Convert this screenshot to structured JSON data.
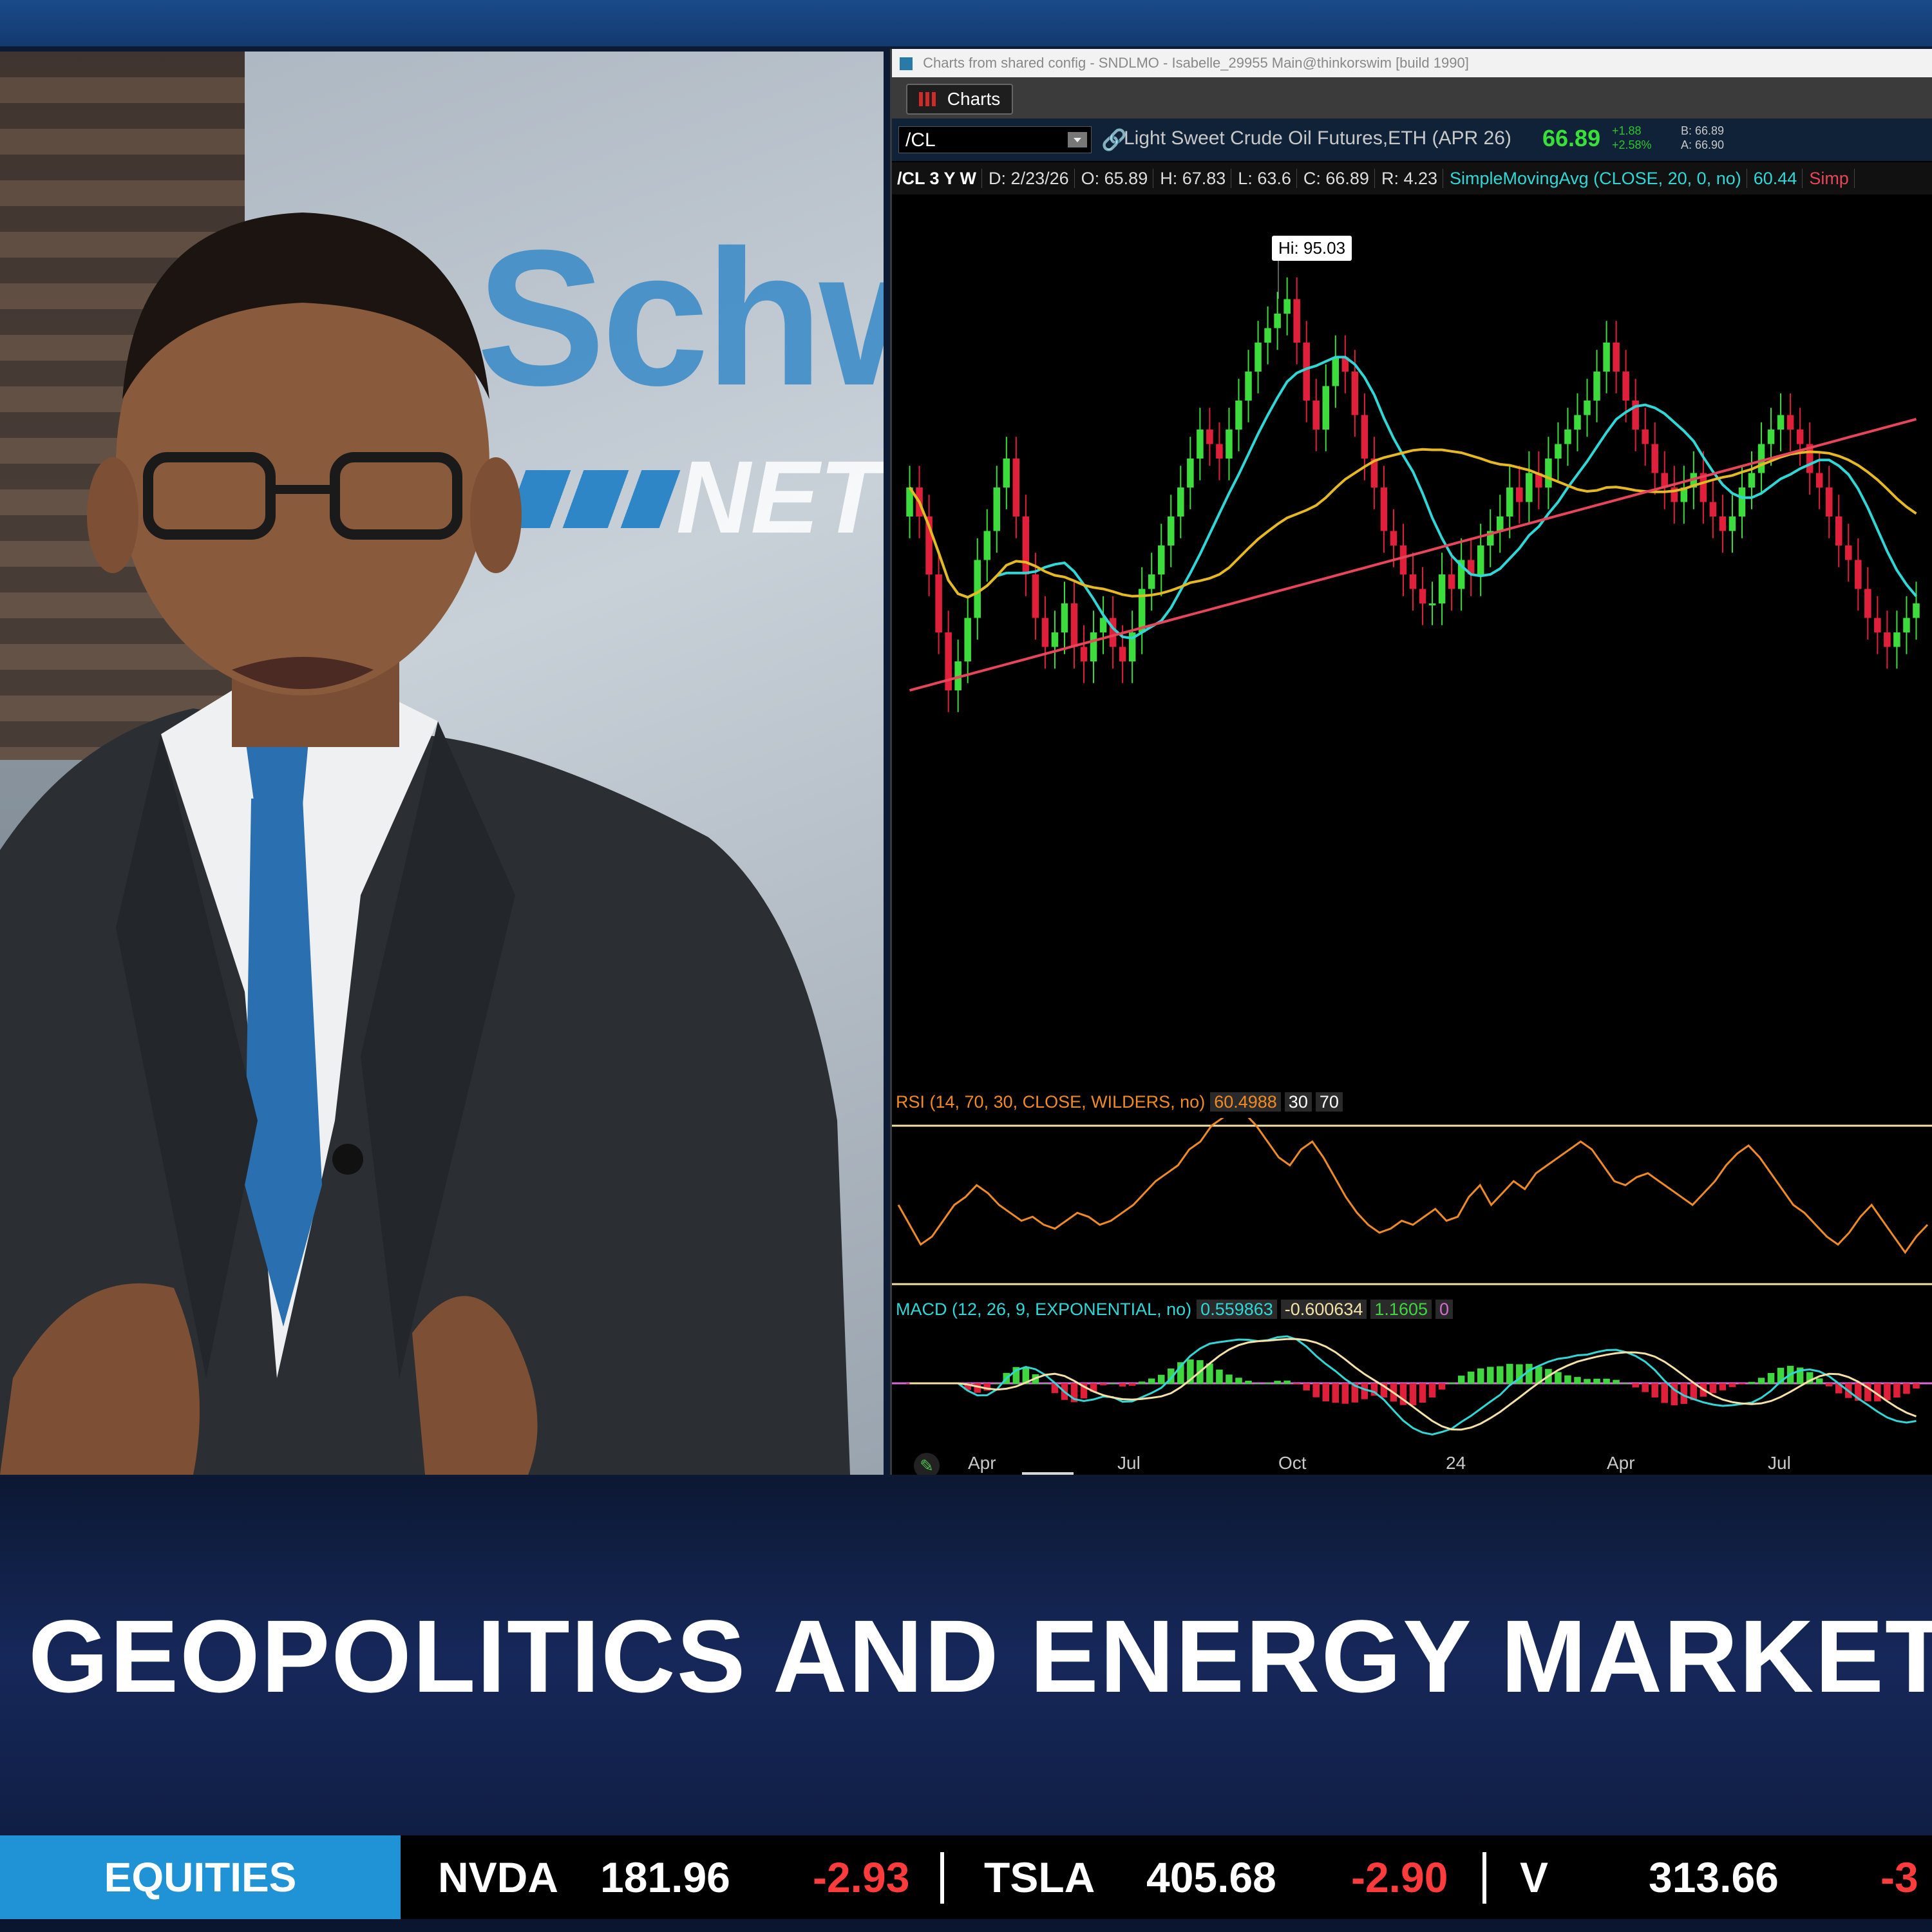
{
  "window": {
    "title": "Charts from shared config - SNDLMO - Isabelle_29955 Main@thinkorswim [build 1990]",
    "tab_label": "Charts"
  },
  "symbol_bar": {
    "symbol": "/CL",
    "description": "Light Sweet Crude Oil Futures,ETH (APR 26)",
    "last": "66.89",
    "net_change": "+1.88",
    "pct_change": "+2.58%",
    "bid": "B: 66.89",
    "ask": "A: 66.90"
  },
  "study_bar": {
    "period": "/CL 3 Y W",
    "date": "D: 2/23/26",
    "open": "O: 65.89",
    "high": "H: 67.83",
    "low": "L: 63.6",
    "close": "C: 66.89",
    "range": "R: 4.23",
    "sma": "SimpleMovingAvg (CLOSE, 20, 0, no)",
    "sma_value": "60.44",
    "sma2_cut": "Simp"
  },
  "hi_label": "Hi: 95.03",
  "rsi": {
    "label": "RSI (14, 70, 30, CLOSE, WILDERS, no)",
    "value": "60.4988",
    "oversold": "30",
    "overbought": "70"
  },
  "macd": {
    "label": "MACD (12, 26, 9, EXPONENTIAL, no)",
    "value": "0.559863",
    "avg": "-0.600634",
    "diff": "1.1605",
    "zero": "0"
  },
  "x_axis": [
    "Apr",
    "Jul",
    "Oct",
    "24",
    "Apr",
    "Jul"
  ],
  "chart_data": {
    "type": "candlestick",
    "title": "/CL 3 Y W",
    "interval": "weekly",
    "colors": {
      "up": "#3bdc3b",
      "down": "#e0203a",
      "sma20": "#2fd7d7",
      "sma50": "#e6b822",
      "sma200": "#e8445a",
      "rsi": "#f08a24",
      "macd": "#2fd7d7",
      "macd_avg": "#f3e1a8"
    },
    "highlight": {
      "label": "Hi: 95.03",
      "value": 95.03
    },
    "ohlc_close": [
      82,
      80,
      76,
      72,
      68,
      70,
      73,
      77,
      79,
      82,
      84,
      80,
      76,
      73,
      71,
      72,
      74,
      71,
      70,
      72,
      73,
      71,
      70,
      72,
      75,
      76,
      78,
      80,
      82,
      84,
      86,
      85,
      84,
      86,
      88,
      90,
      92,
      93,
      94,
      95,
      92,
      88,
      86,
      89,
      91,
      90,
      87,
      84,
      82,
      79,
      78,
      76,
      75,
      74,
      74,
      76,
      75,
      77,
      76,
      78,
      79,
      80,
      82,
      81,
      83,
      82,
      84,
      85,
      86,
      87,
      88,
      90,
      92,
      90,
      88,
      86,
      85,
      83,
      82,
      81,
      82,
      83,
      81,
      80,
      79,
      80,
      82,
      83,
      85,
      86,
      87,
      86,
      85,
      83,
      82,
      80,
      78,
      77,
      75,
      73,
      72,
      71,
      72,
      73,
      74
    ],
    "rsi_values": [
      50,
      45,
      40,
      42,
      46,
      50,
      52,
      55,
      53,
      50,
      48,
      46,
      47,
      45,
      44,
      46,
      48,
      47,
      45,
      46,
      48,
      50,
      53,
      56,
      58,
      60,
      64,
      66,
      70,
      72,
      74,
      73,
      70,
      66,
      62,
      60,
      64,
      66,
      62,
      57,
      52,
      48,
      45,
      43,
      44,
      46,
      45,
      47,
      49,
      46,
      47,
      52,
      55,
      50,
      53,
      56,
      54,
      58,
      60,
      62,
      64,
      66,
      64,
      60,
      56,
      55,
      57,
      58,
      56,
      54,
      52,
      50,
      53,
      56,
      60,
      63,
      65,
      62,
      58,
      54,
      50,
      48,
      45,
      42,
      40,
      43,
      47,
      50,
      46,
      42,
      38,
      42,
      45
    ]
  },
  "lower_third": {
    "headline": "GEOPOLITICS AND ENERGY MARKETS"
  },
  "ticker": {
    "section": "EQUITIES",
    "items": [
      {
        "symbol": "NVDA",
        "price": "181.96",
        "change": "-2.93"
      },
      {
        "symbol": "TSLA",
        "price": "405.68",
        "change": "-2.90"
      },
      {
        "symbol": "V",
        "price": "313.66",
        "change": "-3"
      }
    ]
  },
  "studio": {
    "wall_logo": "Schw",
    "wall_logo_sub": "NET"
  }
}
